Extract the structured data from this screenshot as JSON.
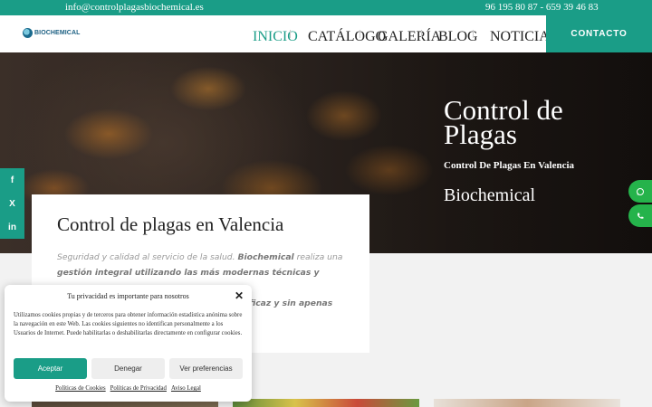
{
  "topbar": {
    "email": "info@controlplagasbiochemical.es",
    "phones": "96 195 80 87 - 659 39 46 83"
  },
  "header": {
    "logo_text": "BIOCHEMICAL",
    "nav": [
      "INICIO",
      "CATÁLOGO",
      "GALERÍA",
      "BLOG",
      "NOTICIAS"
    ],
    "active_nav": "INICIO",
    "contact_label": "CONTACTO"
  },
  "hero": {
    "title": "Control de Plagas",
    "subtitle": "Control De Plagas En Valencia",
    "brand": "Biochemical"
  },
  "social": {
    "facebook": "f",
    "twitter": "X",
    "linkedin": "in"
  },
  "card": {
    "title": "Control de plagas en Valencia",
    "text_intro": "Seguridad y calidad al servicio de la salud. ",
    "text_brand": "Biochemical",
    "text_mid": " realiza una ",
    "text_bold": "gestión integral utilizando las más modernas técnicas y procesos",
    "text_tail": "ficaz y sin apenas"
  },
  "cookie": {
    "title": "Tu privacidad es importante para nosotros",
    "body": "Utilizamos cookies propias y de terceros para obtener información estadística anónima sobre la navegación en este Web. Las cookies siguientes no identifican personalmente a los Usuarios de Internet. Puede habilitarlas o deshabilitarlas directamente en configurar cookies.",
    "accept": "Aceptar",
    "deny": "Denegar",
    "preferences": "Ver preferencias",
    "links": [
      "Políticas de Cookies",
      "Políticas de Privacidad",
      "Aviso Legal"
    ]
  },
  "colors": {
    "brand": "#1a9d87",
    "float_green": "#25b34b"
  },
  "icons": {
    "whatsapp": "whatsapp-icon",
    "phone": "phone-icon",
    "close": "close-icon"
  }
}
